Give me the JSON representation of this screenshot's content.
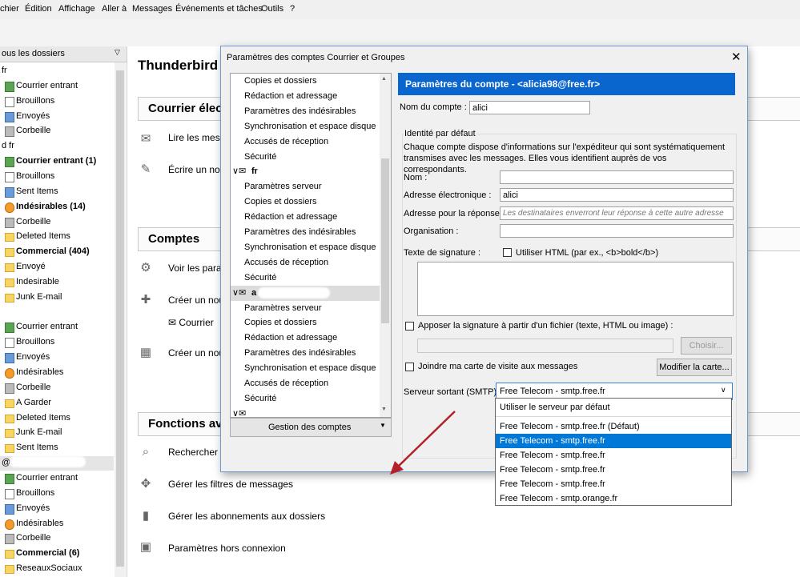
{
  "menubar": [
    "chier",
    "Édition",
    "Affichage",
    "Aller à",
    "Messages",
    "Événements et tâches",
    "Outils",
    "?"
  ],
  "folder_pane": {
    "header": "ous les dossiers",
    "rows": [
      {
        "label": "fr",
        "type": "account",
        "bold": false
      },
      {
        "label": "Courrier entrant",
        "type": "inbox",
        "bold": false
      },
      {
        "label": "Brouillons",
        "type": "draft",
        "bold": false
      },
      {
        "label": "Envoyés",
        "type": "sent",
        "bold": false
      },
      {
        "label": "Corbeille",
        "type": "trash",
        "bold": false
      },
      {
        "label": "d                    fr",
        "type": "account",
        "bold": false
      },
      {
        "label": "Courrier entrant (1)",
        "type": "inbox",
        "bold": true
      },
      {
        "label": "Brouillons",
        "type": "draft",
        "bold": false
      },
      {
        "label": "Sent Items",
        "type": "sent",
        "bold": false
      },
      {
        "label": "Indésirables (14)",
        "type": "junk",
        "bold": true
      },
      {
        "label": "Corbeille",
        "type": "trash",
        "bold": false
      },
      {
        "label": "Deleted Items",
        "type": "folder",
        "bold": false
      },
      {
        "label": "Commercial (404)",
        "type": "folder",
        "bold": true
      },
      {
        "label": "Envoyé",
        "type": "folder",
        "bold": false
      },
      {
        "label": "Indesirable",
        "type": "folder",
        "bold": false
      },
      {
        "label": "Junk E-mail",
        "type": "folder",
        "bold": false
      },
      {
        "label": "",
        "type": "account",
        "bold": false
      },
      {
        "label": "Courrier entrant",
        "type": "inbox",
        "bold": false
      },
      {
        "label": "Brouillons",
        "type": "draft",
        "bold": false
      },
      {
        "label": "Envoyés",
        "type": "sent",
        "bold": false
      },
      {
        "label": "Indésirables",
        "type": "junk",
        "bold": false
      },
      {
        "label": "Corbeille",
        "type": "trash",
        "bold": false
      },
      {
        "label": "A Garder",
        "type": "folder",
        "bold": false
      },
      {
        "label": "Deleted Items",
        "type": "folder",
        "bold": false
      },
      {
        "label": "Junk E-mail",
        "type": "folder",
        "bold": false
      },
      {
        "label": "Sent Items",
        "type": "folder",
        "bold": false
      },
      {
        "label": "@wa",
        "type": "account",
        "bold": false
      },
      {
        "label": "Courrier entrant",
        "type": "inbox",
        "bold": false
      },
      {
        "label": "Brouillons",
        "type": "draft",
        "bold": false
      },
      {
        "label": "Envoyés",
        "type": "sent",
        "bold": false
      },
      {
        "label": "Indésirables",
        "type": "junk",
        "bold": false
      },
      {
        "label": "Corbeille",
        "type": "trash",
        "bold": false
      },
      {
        "label": "Commercial (6)",
        "type": "folder",
        "bold": true
      },
      {
        "label": "ReseauxSociaux",
        "type": "folder",
        "bold": false
      }
    ]
  },
  "main": {
    "title": "Thunderbird",
    "sections": [
      "Courrier électronique",
      "Comptes",
      "Fonctions avancées"
    ],
    "actions": [
      "Lire les messages",
      "Écrire un nouveau message",
      "Voir les paramètres de ce compte",
      "Créer un nouveau compte :",
      "Courrier",
      "Créer un nouvel agenda",
      "Rechercher",
      "Gérer les filtres de messages",
      "Gérer les abonnements aux dossiers",
      "Paramètres hors connexion"
    ]
  },
  "dialog": {
    "title": "Paramètres des comptes Courrier et Groupes",
    "close": "✕",
    "tree": [
      {
        "label": "Copies et dossiers",
        "acc": false
      },
      {
        "label": "Rédaction et adressage",
        "acc": false
      },
      {
        "label": "Paramètres des indésirables",
        "acc": false
      },
      {
        "label": "Synchronisation et espace disque",
        "acc": false
      },
      {
        "label": "Accusés de réception",
        "acc": false
      },
      {
        "label": "Sécurité",
        "acc": false
      },
      {
        "label": "fr",
        "acc": true
      },
      {
        "label": "Paramètres serveur",
        "acc": false
      },
      {
        "label": "Copies et dossiers",
        "acc": false
      },
      {
        "label": "Rédaction et adressage",
        "acc": false
      },
      {
        "label": "Paramètres des indésirables",
        "acc": false
      },
      {
        "label": "Synchronisation et espace disque",
        "acc": false
      },
      {
        "label": "Accusés de réception",
        "acc": false
      },
      {
        "label": "Sécurité",
        "acc": false
      },
      {
        "label": "a",
        "acc": true
      },
      {
        "label": "Paramètres serveur",
        "acc": false
      },
      {
        "label": "Copies et dossiers",
        "acc": false
      },
      {
        "label": "Rédaction et adressage",
        "acc": false
      },
      {
        "label": "Paramètres des indésirables",
        "acc": false
      },
      {
        "label": "Synchronisation et espace disque",
        "acc": false
      },
      {
        "label": "Accusés de réception",
        "acc": false
      },
      {
        "label": "Sécurité",
        "acc": false
      },
      {
        "label": "",
        "acc": true
      }
    ],
    "manage_button": "Gestion des comptes",
    "header": "Paramètres du compte - <alicia98@free.fr>",
    "account_name_label": "Nom du compte :",
    "account_name_value": "alici",
    "identity_legend": "Identité par défaut",
    "identity_desc": "Chaque compte dispose d'informations sur l'expéditeur qui sont systématiquement transmises avec les messages. Elles vous identifient auprès de vos correspondants.",
    "name_label": "Nom :",
    "name_value": "",
    "email_label": "Adresse électronique :",
    "email_value": "alici",
    "reply_label": "Adresse pour la réponse :",
    "reply_placeholder": "Les destinataires enverront leur réponse à cette autre adresse",
    "org_label": "Organisation :",
    "org_value": "",
    "sig_label": "Texte de signature :",
    "html_label": "Utiliser HTML (par ex., <b>bold</b>)",
    "attach_sig_label": "Apposer la signature à partir d'un fichier (texte, HTML ou image) :",
    "choose_button": "Choisir...",
    "vcard_label": "Joindre ma carte de visite aux messages",
    "edit_card_button": "Modifier la carte...",
    "smtp_label": "Serveur sortant (SMTP) :",
    "smtp_value": "Free Telecom - smtp.free.fr"
  },
  "smtp_options": [
    {
      "label": "Utiliser le serveur par défaut",
      "selected": false
    },
    {
      "label": "Free Telecom - smtp.free.fr (Défaut)",
      "selected": false
    },
    {
      "label": "Free Telecom - smtp.free.fr",
      "selected": true
    },
    {
      "label": "Free Telecom - smtp.free.fr",
      "selected": false
    },
    {
      "label": "Free Telecom - smtp.free.fr",
      "selected": false
    },
    {
      "label": "Free Telecom - smtp.free.fr",
      "selected": false
    },
    {
      "label": "Free Telecom - smtp.orange.fr",
      "selected": false
    }
  ],
  "colors": {
    "header_blue": "#0a66cf",
    "selection_blue": "#0078d7",
    "arrow_red": "#b3202a"
  }
}
